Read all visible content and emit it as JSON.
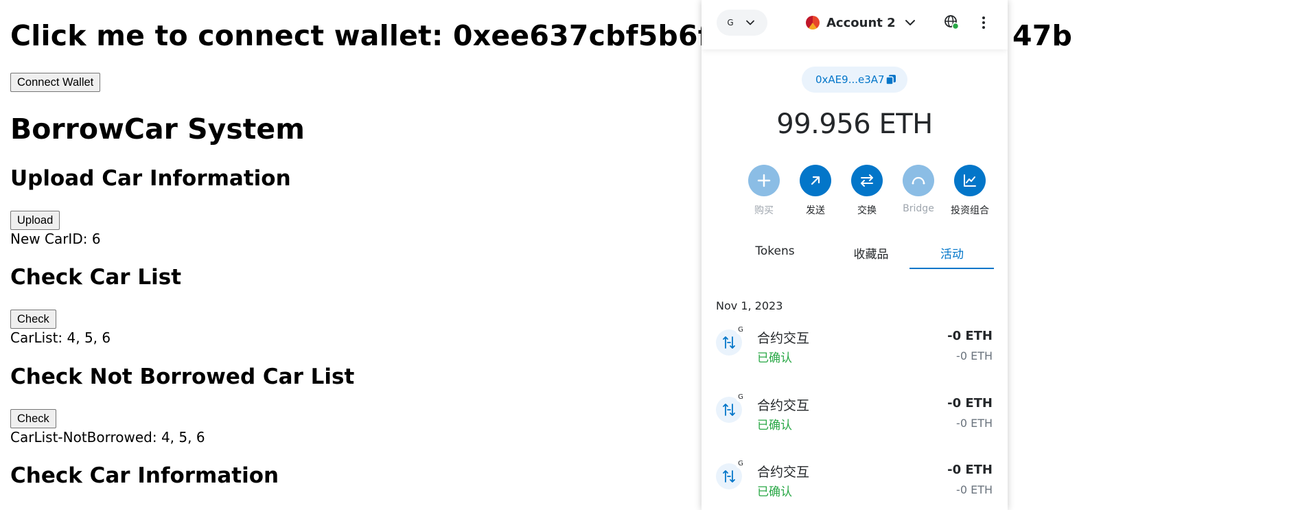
{
  "main": {
    "connect_heading": "Click me to connect wallet: 0xee637cbf5b6f1cf956",
    "connect_heading_tail": "47b",
    "connect_button": "Connect Wallet",
    "system_title": "BorrowCar System",
    "upload_heading": "Upload Car Information",
    "upload_button": "Upload",
    "new_car_id": "New CarID: 6",
    "check_list_heading": "Check Car List",
    "check_list_button": "Check",
    "car_list": "CarList: 4, 5, 6",
    "not_borrowed_heading": "Check Not Borrowed Car List",
    "not_borrowed_button": "Check",
    "not_borrowed_list": "CarList-NotBorrowed: 4, 5, 6",
    "car_info_heading": "Check Car Information"
  },
  "wallet": {
    "network_label": "G",
    "account_name": "Account 2",
    "address": "0xAE9...e3A7",
    "balance": "99.956 ETH",
    "actions": [
      {
        "label": "购买",
        "icon": "plus-icon",
        "dim": true
      },
      {
        "label": "发送",
        "icon": "send-arrow-icon",
        "dim": false
      },
      {
        "label": "交换",
        "icon": "swap-icon",
        "dim": false
      },
      {
        "label": "Bridge",
        "icon": "bridge-icon",
        "dim": true
      },
      {
        "label": "投资组合",
        "icon": "portfolio-chart-icon",
        "dim": false
      }
    ],
    "tabs": [
      "Tokens",
      "收藏品",
      "活动"
    ],
    "active_tab": "活动",
    "activity_date": "Nov 1, 2023",
    "transactions": [
      {
        "title": "合约交互",
        "status": "已确认",
        "amount": "-0 ETH",
        "amount_sub": "-0 ETH",
        "badge": "G"
      },
      {
        "title": "合约交互",
        "status": "已确认",
        "amount": "-0 ETH",
        "amount_sub": "-0 ETH",
        "badge": "G"
      },
      {
        "title": "合约交互",
        "status": "已确认",
        "amount": "-0 ETH",
        "amount_sub": "-0 ETH",
        "badge": "G"
      }
    ],
    "colors": {
      "accent": "#0376c9",
      "accent_dim": "#8bbde5",
      "success": "#28a745"
    }
  }
}
